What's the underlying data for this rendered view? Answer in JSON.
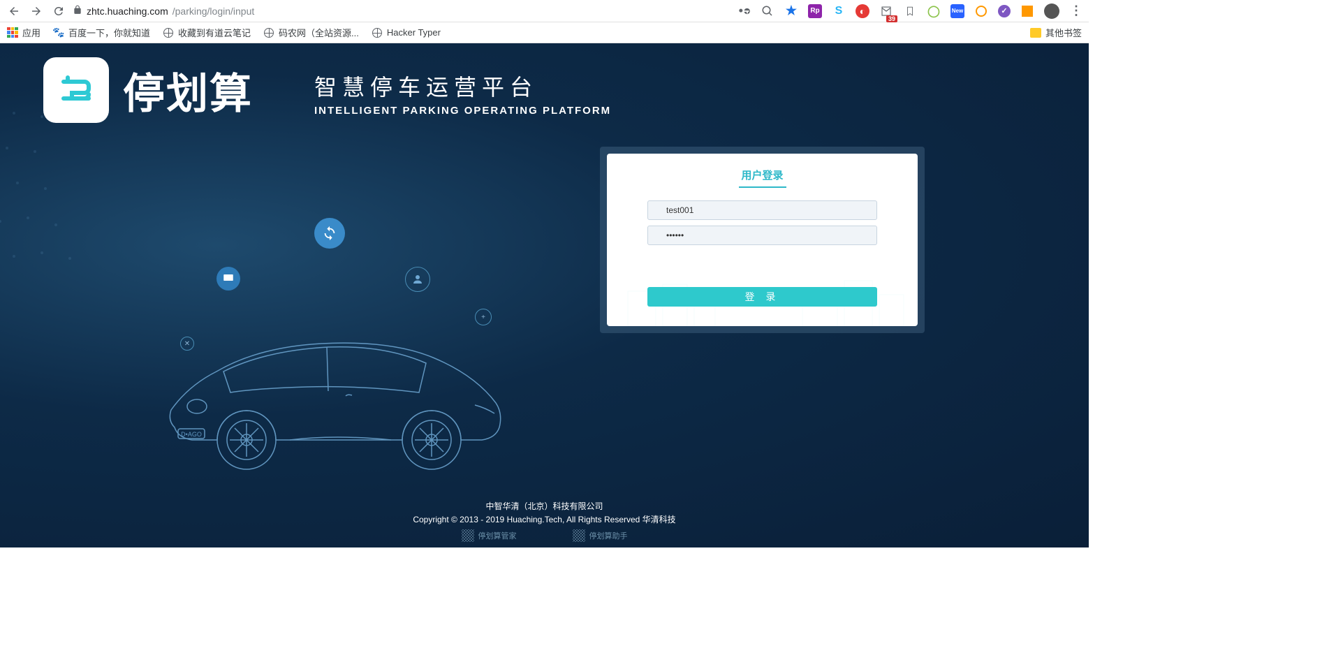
{
  "browser": {
    "url_domain": "zhtc.huaching.com",
    "url_path": "/parking/login/input",
    "mail_badge": "39",
    "new_badge": "New"
  },
  "bookmarks": {
    "apps": "应用",
    "baidu": "百度一下，你就知道",
    "youdao": "收藏到有道云笔记",
    "manong": "码农网（全站资源...",
    "hacker": "Hacker Typer",
    "other": "其他书签"
  },
  "branding": {
    "logo_text": "停划算",
    "subtitle_cn": "智慧停车运营平台",
    "subtitle_en": "INTELLIGENT PARKING OPERATING PLATFORM"
  },
  "login": {
    "title": "用户登录",
    "username_value": "test001",
    "password_value": "••••••",
    "button": "登 录"
  },
  "footer": {
    "company": "中智华清（北京）科技有限公司",
    "copyright": "Copyright © 2013 - 2019 Huaching.Tech, All Rights Reserved 华清科技",
    "qr1": "停划算管家",
    "qr2": "停划算助手"
  }
}
